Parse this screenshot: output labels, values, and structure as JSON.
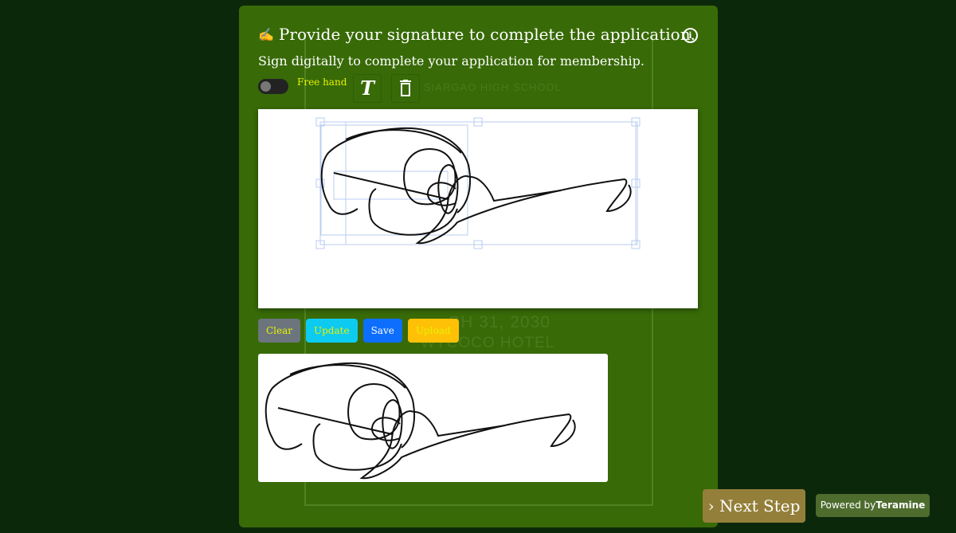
{
  "header": {
    "title": "Provide your signature to complete the application.",
    "subtitle": "Sign digitally to complete your application for membership.",
    "title_icon": "signature-icon",
    "info_icon": "info-icon"
  },
  "toolbar": {
    "mode_label": "Free hand",
    "text_icon": "T",
    "trash_icon": "trash-icon",
    "freehand_enabled": false
  },
  "watermark": {
    "school": "SIARGAO HIGH SCHOOL",
    "date": "CH 31, 2030",
    "venue": "WYCOCO HOTEL"
  },
  "actions": {
    "clear": "Clear",
    "update": "Update",
    "save": "Save",
    "upload": "Upload"
  },
  "colors": {
    "clear": "#6c757d",
    "update": "#0dcaf0",
    "save": "#0d6efd",
    "upload": "#ffc107",
    "card": "#386a07",
    "next": "#947f3a"
  },
  "footer": {
    "next_label": "Next Step",
    "next_chevron": "›",
    "powered_by": "Powered by",
    "brand": "Teramine"
  }
}
